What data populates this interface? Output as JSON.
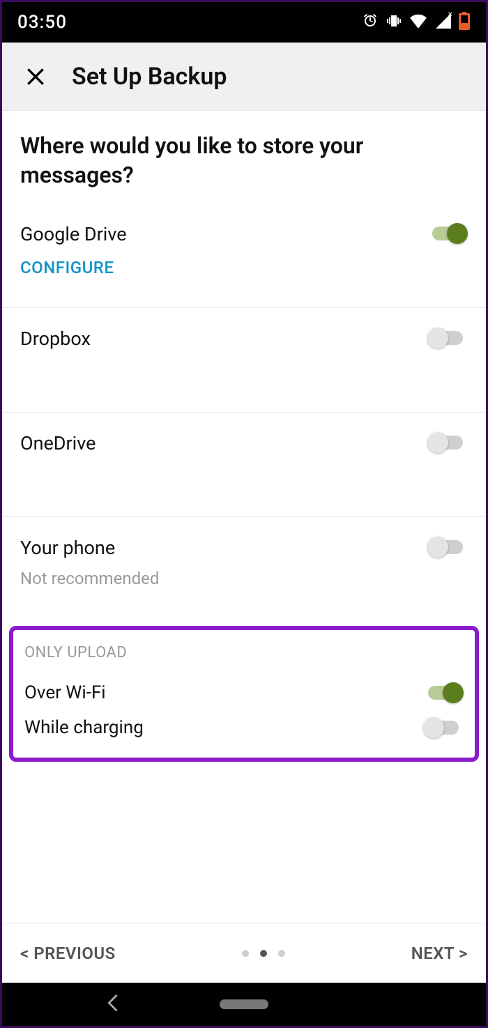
{
  "status": {
    "time": "03:50"
  },
  "header": {
    "title": "Set Up Backup"
  },
  "question": "Where would you like to store your messages?",
  "options": [
    {
      "title": "Google Drive",
      "action": "CONFIGURE",
      "on": true
    },
    {
      "title": "Dropbox",
      "on": false
    },
    {
      "title": "OneDrive",
      "on": false
    },
    {
      "title": "Your phone",
      "sub": "Not recommended",
      "on": false
    }
  ],
  "upload": {
    "section_label": "ONLY UPLOAD",
    "rows": [
      {
        "label": "Over Wi-Fi",
        "on": true
      },
      {
        "label": "While charging",
        "on": false
      }
    ]
  },
  "footer": {
    "prev": "< PREVIOUS",
    "next": "NEXT >",
    "page": 2,
    "total": 3
  }
}
